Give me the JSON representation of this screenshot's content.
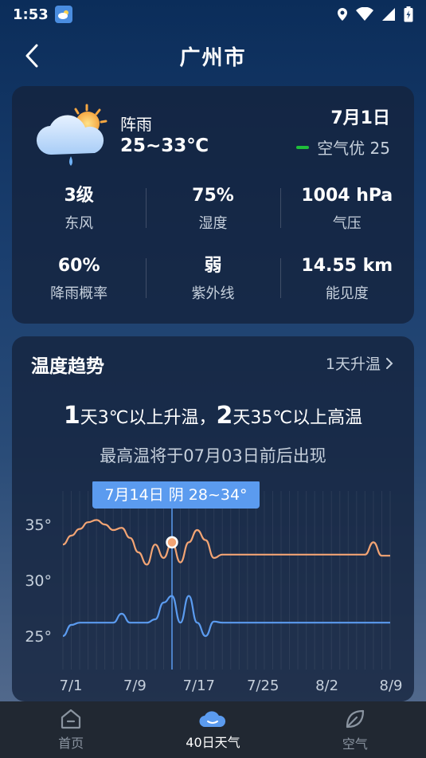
{
  "status_bar": {
    "time": "1:53"
  },
  "header": {
    "title": "广州市"
  },
  "today": {
    "condition": "阵雨",
    "temp_range": "25~33℃",
    "date": "7月1日",
    "aqi_text": "空气优 25",
    "stats": [
      {
        "value": "3级",
        "label": "东风"
      },
      {
        "value": "75%",
        "label": "湿度"
      },
      {
        "value": "1004 hPa",
        "label": "气压"
      },
      {
        "value": "60%",
        "label": "降雨概率"
      },
      {
        "value": "弱",
        "label": "紫外线"
      },
      {
        "value": "14.55 km",
        "label": "能见度"
      }
    ]
  },
  "trend": {
    "title": "温度趋势",
    "link_label": "1天升温",
    "summary_num1": "1",
    "summary_part1": "天3℃以上升温，",
    "summary_num2": "2",
    "summary_part2": "天35℃以上高温",
    "subline": "最高温将于07月03日前后出现",
    "tooltip": "7月14日 阴 28~34°"
  },
  "chart_data": {
    "type": "line",
    "x_tick_labels": [
      "7/1",
      "7/9",
      "7/17",
      "7/25",
      "8/2",
      "8/9"
    ],
    "y_tick_labels": [
      "35°",
      "30°",
      "25°"
    ],
    "y_ticks": [
      35,
      30,
      25
    ],
    "ylim": [
      22,
      38
    ],
    "x_days": 40,
    "highlight_day": 13,
    "grid": true,
    "colors": {
      "high": "#f2a474",
      "low": "#5b9bef",
      "tooltip": "#5b9bef"
    },
    "series": [
      {
        "values": [
          33.2,
          34,
          34.6,
          35.2,
          35.4,
          35,
          34.5,
          34.7,
          33.8,
          32.5,
          31.4,
          33.2,
          32,
          33.4,
          31.6,
          33.4,
          34.5,
          33.6,
          32,
          32.3,
          32.3,
          32.3,
          32.3,
          32.3,
          32.3,
          32.3,
          32.3,
          32.3,
          32.3,
          32.3,
          32.3,
          32.3,
          32.3,
          32.3,
          32.3,
          32.3,
          32.3,
          33.4,
          32.2,
          32.2
        ]
      },
      {
        "values": [
          25,
          26,
          26.2,
          26.2,
          26.2,
          26.2,
          26.2,
          27,
          26.2,
          26.2,
          26.2,
          26.5,
          28,
          28.6,
          26.2,
          28.6,
          26.2,
          25,
          26.3,
          26.2,
          26.2,
          26.2,
          26.2,
          26.2,
          26.2,
          26.2,
          26.2,
          26.2,
          26.2,
          26.2,
          26.2,
          26.2,
          26.2,
          26.2,
          26.2,
          26.2,
          26.2,
          26.2,
          26.2,
          26.2
        ]
      }
    ]
  },
  "tabbar": {
    "tabs": [
      {
        "label": "首页"
      },
      {
        "label": "40日天气"
      },
      {
        "label": "空气"
      }
    ]
  }
}
